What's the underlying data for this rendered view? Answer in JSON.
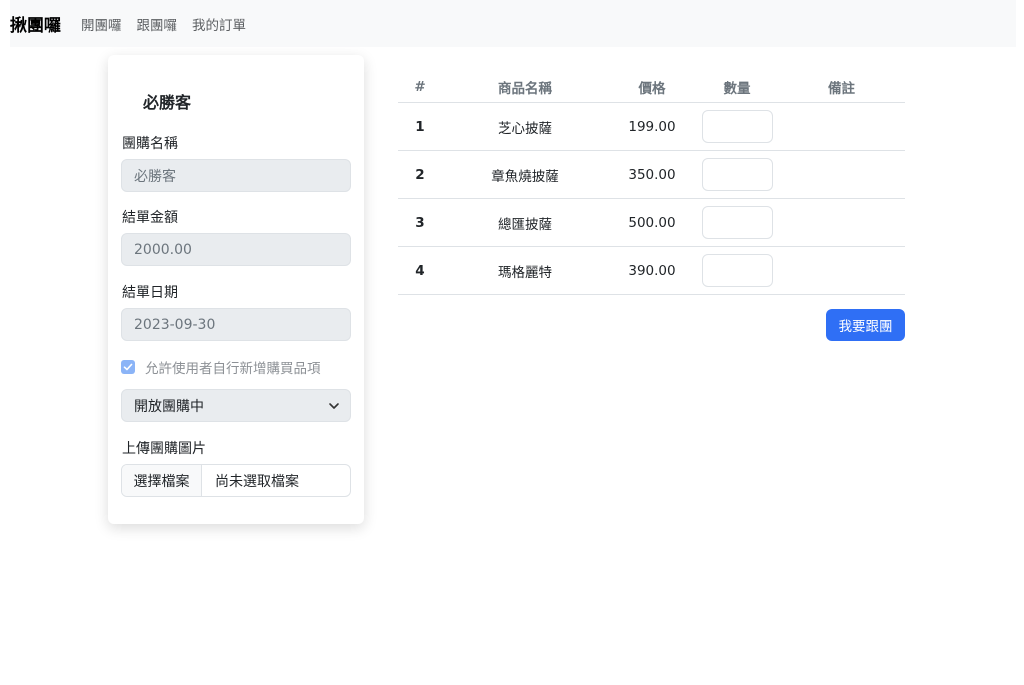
{
  "navbar": {
    "brand": "揪團囉",
    "links": [
      "開團囉",
      "跟團囉",
      "我的訂單"
    ]
  },
  "form": {
    "title": "必勝客",
    "group_name_label": "團購名稱",
    "group_name_value": "必勝客",
    "amount_label": "結單金額",
    "amount_value": "2000.00",
    "date_label": "結單日期",
    "date_value": "2023-09-30",
    "allow_add_label": "允許使用者自行新增購買品項",
    "allow_add_checked": true,
    "status_value": "開放團購中",
    "upload_label": "上傳團購圖片",
    "file_button": "選擇檔案",
    "file_name": "尚未選取檔案"
  },
  "table": {
    "headers": [
      "#",
      "商品名稱",
      "價格",
      "數量",
      "備註"
    ],
    "rows": [
      {
        "no": "1",
        "name": "芝心披薩",
        "price": "199.00"
      },
      {
        "no": "2",
        "name": "章魚燒披薩",
        "price": "350.00"
      },
      {
        "no": "3",
        "name": "總匯披薩",
        "price": "500.00"
      },
      {
        "no": "4",
        "name": "瑪格麗特",
        "price": "390.00"
      }
    ]
  },
  "join_button": "我要跟團",
  "colors": {
    "primary": "#2f6ff5",
    "navbar_bg": "#f8f9fa",
    "readonly_bg": "#e9ecef"
  }
}
